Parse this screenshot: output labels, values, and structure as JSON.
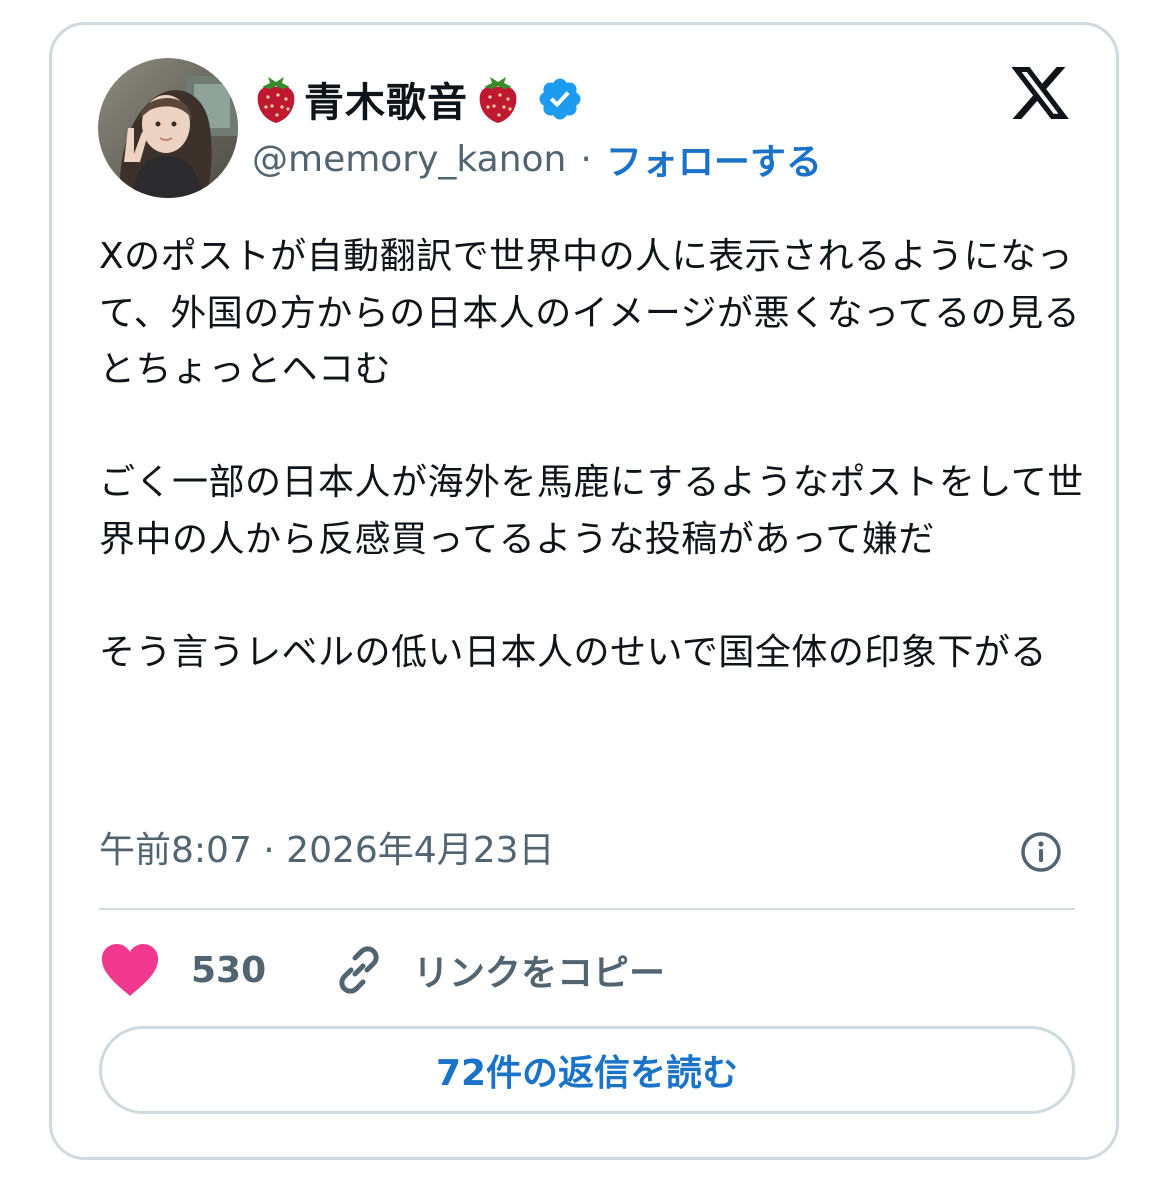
{
  "user": {
    "display_name": "青木歌音",
    "name_emoji_left": "strawberry-icon",
    "name_emoji_right": "strawberry-icon",
    "verified": true,
    "handle": "@memory_kanon",
    "separator": "·",
    "follow_label": "フォローする"
  },
  "post": {
    "text": "Xのポストが自動翻訳で世界中の人に表示されるようになって、外国の方からの日本人のイメージが悪くなってるの見るとちょっとヘコむ\n\nごく一部の日本人が海外を馬鹿にするようなポストをして世界中の人から反感買ってるような投稿があって嫌だ\n\nそう言うレベルの低い日本人のせいで国全体の印象下がる",
    "timestamp": "午前8:07 · 2026年4月23日"
  },
  "actions": {
    "like_count": "530",
    "copy_link_label": "リンクをコピー",
    "read_replies_label": "72件の返信を読む"
  },
  "colors": {
    "accent": "#1a73c8",
    "verified_blue": "#1d9bf0",
    "like_pink": "#f91880",
    "secondary_text": "#536471",
    "border": "#cfd9de"
  }
}
